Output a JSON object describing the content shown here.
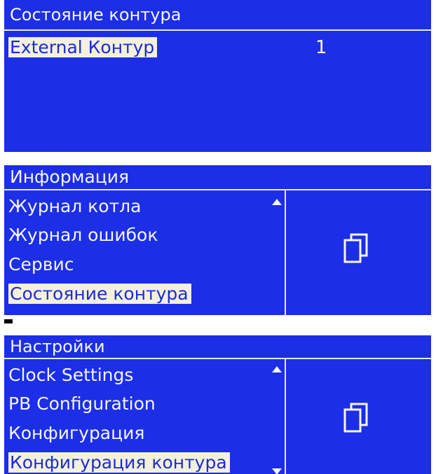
{
  "panel1": {
    "title": "Состояние контура",
    "row_label": "External Контур",
    "row_value": "1"
  },
  "panel2": {
    "title": "Информация",
    "items": [
      "Журнал котла",
      "Журнал ошибок",
      "Сервис",
      "Состояние контура"
    ],
    "selected_index": 3,
    "right_icon": "copy-pages-icon"
  },
  "panel3": {
    "title": "Настройки",
    "items": [
      "Clock Settings",
      "PB Configuration",
      "Конфигурация",
      "Конфигурация контура"
    ],
    "selected_index": 3,
    "right_icon": "copy-pages-icon"
  },
  "colors": {
    "panel_bg": "#1c2ee6",
    "text": "#f4f6ff",
    "highlight_bg": "#f3f1dc",
    "highlight_text": "#1a2bd8"
  }
}
